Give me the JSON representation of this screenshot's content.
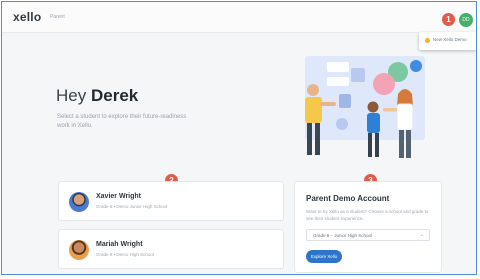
{
  "header": {
    "logo": "xello",
    "logo_sub": "Parent",
    "badge_1": "1",
    "user_initials": "DD",
    "tooltip": "New Xello Demo"
  },
  "main": {
    "greeting_prefix": "Hey",
    "greeting_name": "Derek",
    "subtitle": "Select a student to explore their future-readiness work in Xello."
  },
  "badges": {
    "students": "2",
    "parent": "3"
  },
  "students": [
    {
      "name": "Xavier Wright",
      "school": "Grade 6 • Demo Junior High School"
    },
    {
      "name": "Mariah Wright",
      "school": "Grade 9 • Demo High School"
    }
  ],
  "parent_demo": {
    "title": "Parent Demo Account",
    "description": "Want to try Xello as a student? Choose a school and grade to see their student experience.",
    "select_value": "Grade 6 – Junior High School",
    "button": "Explore Xello"
  },
  "colors": {
    "accent": "#2d75c8",
    "badge": "#e35a4a",
    "user": "#45b06a"
  }
}
